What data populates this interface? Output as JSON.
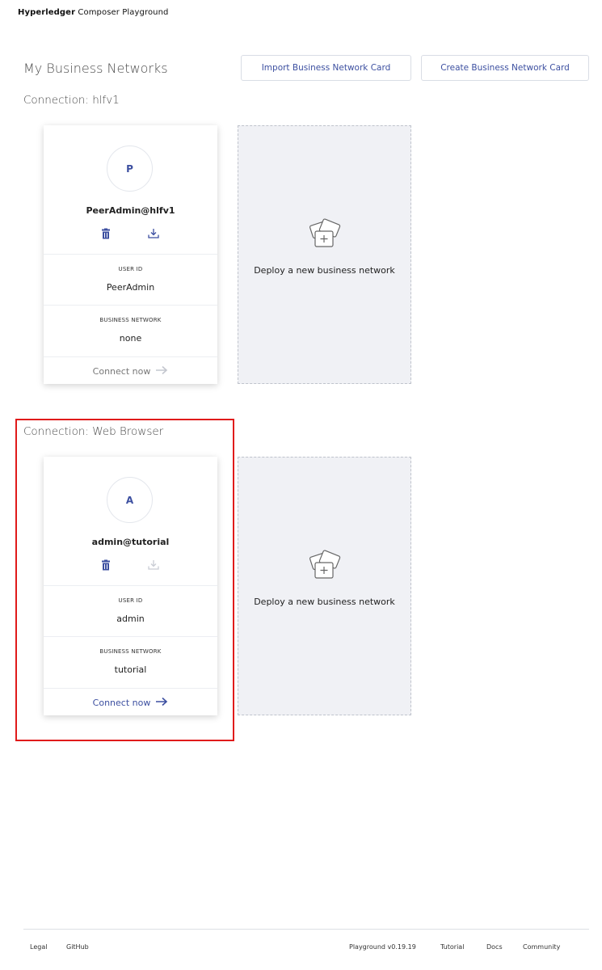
{
  "app": {
    "brand_strong": "Hyperledger",
    "brand_rest": " Composer Playground"
  },
  "header": {
    "title": "My Business Networks",
    "import_label": "Import Business Network Card",
    "create_label": "Create Business Network Card"
  },
  "connections": [
    {
      "heading": "Connection: hlfv1",
      "card": {
        "avatar_letter": "P",
        "name": "PeerAdmin@hlfv1",
        "user_id_label": "USER ID",
        "user_id": "PeerAdmin",
        "network_label": "BUSINESS NETWORK",
        "network": "none",
        "connect_label": "Connect now"
      },
      "deploy_label": "Deploy a new business network"
    },
    {
      "heading": "Connection: Web Browser",
      "card": {
        "avatar_letter": "A",
        "name": "admin@tutorial",
        "user_id_label": "USER ID",
        "user_id": "admin",
        "network_label": "BUSINESS NETWORK",
        "network": "tutorial",
        "connect_label": "Connect now"
      },
      "deploy_label": "Deploy a new business network"
    }
  ],
  "footer": {
    "legal": "Legal",
    "github": "GitHub",
    "version": "Playground v0.19.19",
    "tutorial": "Tutorial",
    "docs": "Docs",
    "community": "Community"
  },
  "colors": {
    "accent": "#3c4fa0",
    "highlight": "#e01b1b",
    "deploy_bg": "#f0f1f5"
  },
  "icons": [
    "trash-icon",
    "download-icon",
    "arrow-right-icon",
    "deploy-network-icon"
  ]
}
